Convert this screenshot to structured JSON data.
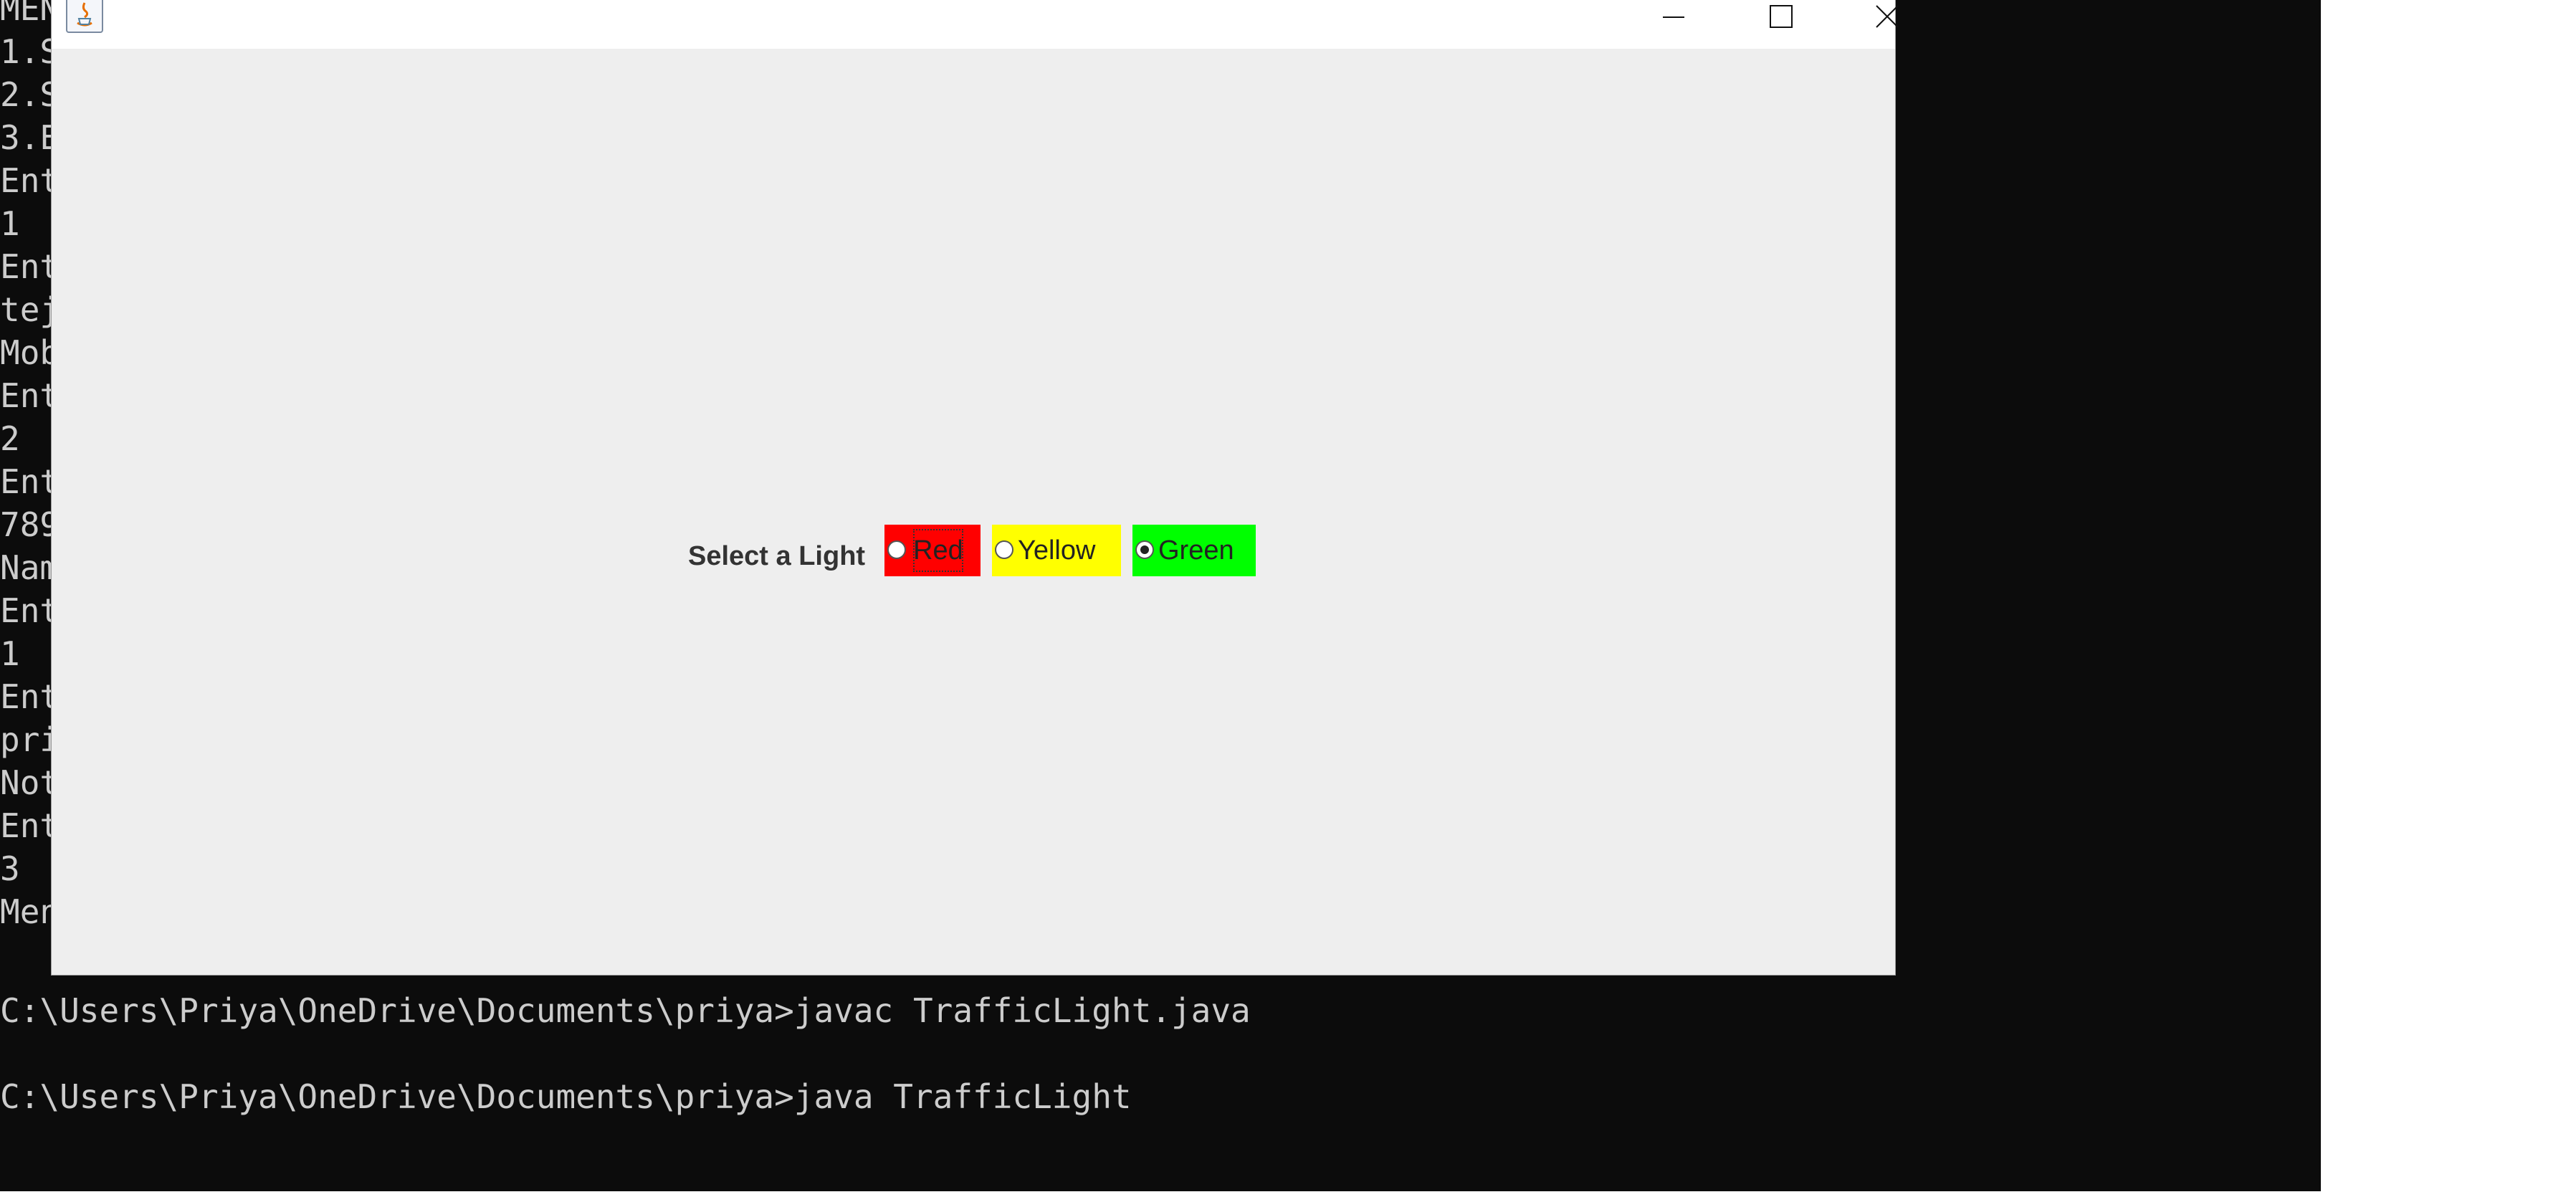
{
  "console": {
    "left_lines": [
      "MEN",
      "1.S",
      "2.S",
      "3.E",
      "Ent",
      "1",
      "Ent",
      "tej",
      "Mob",
      "Ent",
      "2",
      "Ent",
      "789",
      "Nam",
      "Ent",
      "1",
      "Ent",
      "pri",
      "Not",
      "Ent",
      "3",
      "Men"
    ],
    "prompt_line_1": "C:\\Users\\Priya\\OneDrive\\Documents\\priya>javac TrafficLight.java",
    "prompt_line_2": "C:\\Users\\Priya\\OneDrive\\Documents\\priya>java TrafficLight"
  },
  "window": {
    "icon": "java-icon",
    "controls": [
      "minimize-icon",
      "maximize-icon",
      "close-icon"
    ]
  },
  "form": {
    "label": "Select a Light",
    "options": [
      {
        "label": "Red",
        "color": "#ff0000",
        "selected": false,
        "focused": true
      },
      {
        "label": "Yellow",
        "color": "#ffff00",
        "selected": false,
        "focused": false
      },
      {
        "label": "Green",
        "color": "#00ff00",
        "selected": true,
        "focused": false
      }
    ]
  }
}
